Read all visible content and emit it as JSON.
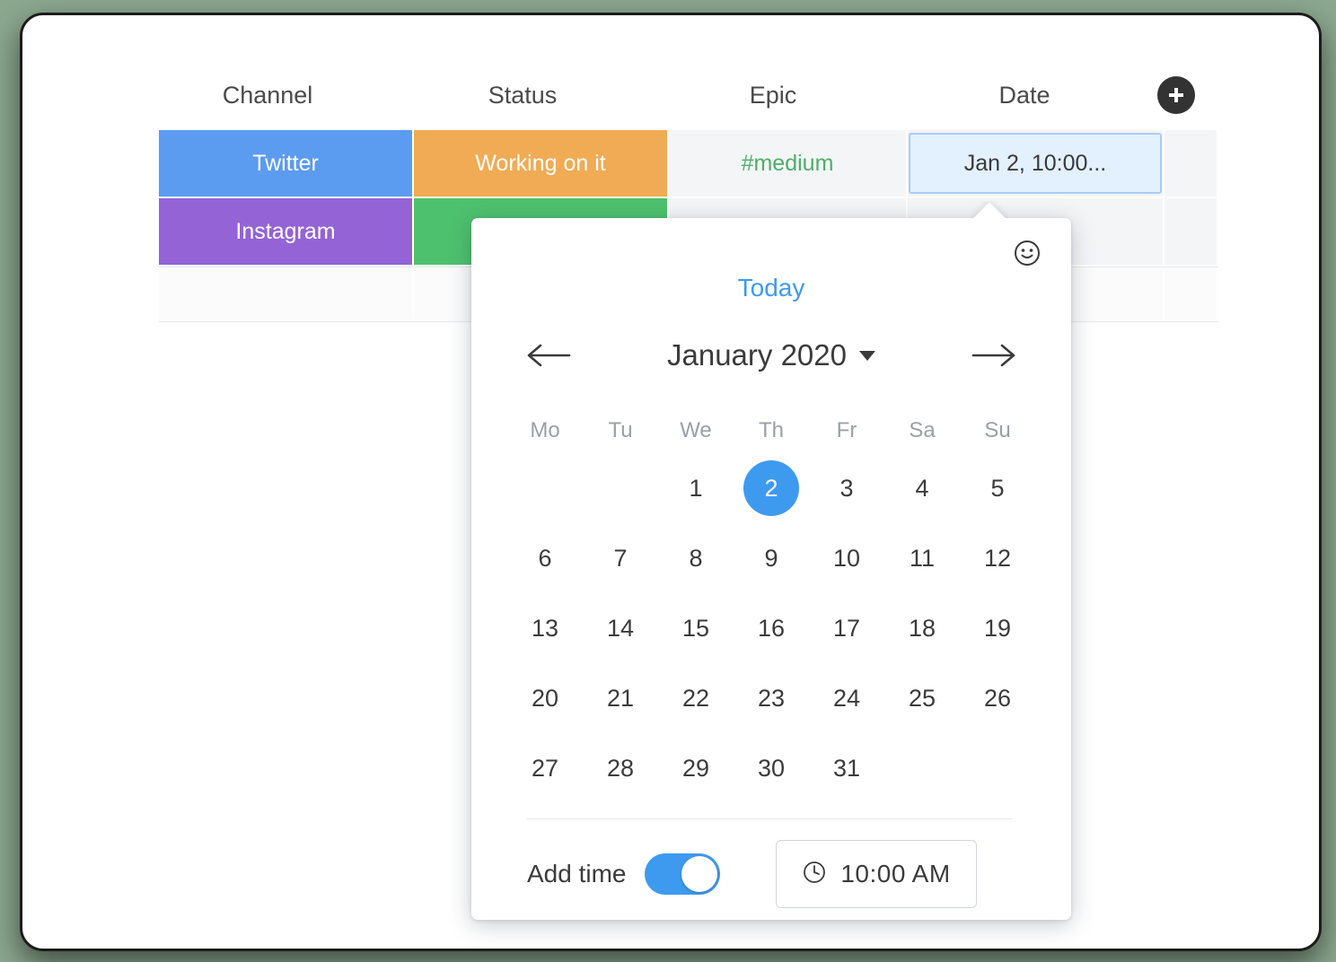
{
  "board": {
    "columns": [
      {
        "label": "Channel"
      },
      {
        "label": "Status"
      },
      {
        "label": "Epic"
      },
      {
        "label": "Date"
      }
    ],
    "add_column_icon": "plus-icon",
    "rows": [
      {
        "channel": "Twitter",
        "channel_color": "#5b9bf0",
        "status": "Working on it",
        "status_color": "#f0ab54",
        "epic": "#medium",
        "epic_color": "#4caf67",
        "date": "Jan 2, 10:00..."
      },
      {
        "channel": "Instagram",
        "channel_color": "#9463d6",
        "status": "",
        "status_color": "#4ec16e",
        "epic": "",
        "epic_color": "#4caf67",
        "date": ""
      }
    ]
  },
  "datepicker": {
    "emoji_icon": "smiley-icon",
    "today_label": "Today",
    "prev_icon": "arrow-left-icon",
    "next_icon": "arrow-right-icon",
    "month_label": "January 2020",
    "month_caret_icon": "chevron-down-icon",
    "weekdays": [
      "Mo",
      "Tu",
      "We",
      "Th",
      "Fr",
      "Sa",
      "Su"
    ],
    "weeks": [
      [
        "",
        "",
        "1",
        "2",
        "3",
        "4",
        "5"
      ],
      [
        "6",
        "7",
        "8",
        "9",
        "10",
        "11",
        "12"
      ],
      [
        "13",
        "14",
        "15",
        "16",
        "17",
        "18",
        "19"
      ],
      [
        "20",
        "21",
        "22",
        "23",
        "24",
        "25",
        "26"
      ],
      [
        "27",
        "28",
        "29",
        "30",
        "31",
        "",
        ""
      ]
    ],
    "selected_day": "2",
    "accent_color": "#3d9aef",
    "add_time_label": "Add time",
    "add_time_on": true,
    "time_icon": "clock-icon",
    "time_value": "10:00 AM"
  }
}
